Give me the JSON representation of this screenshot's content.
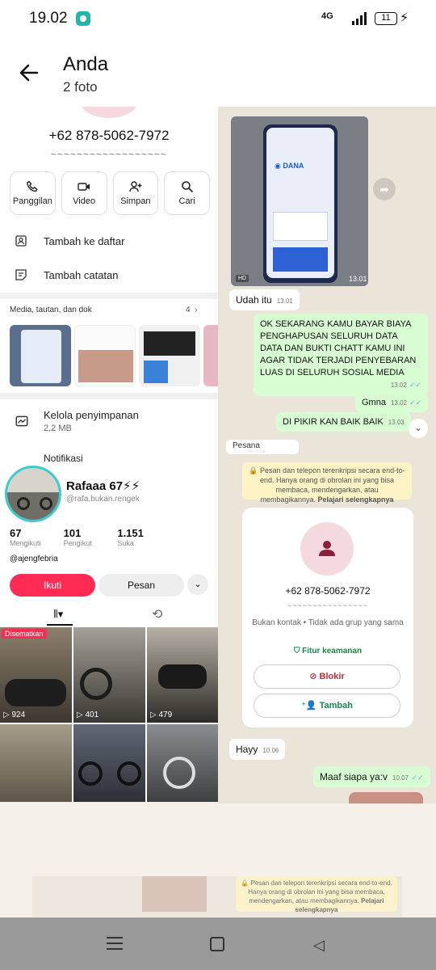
{
  "status_bar": {
    "time": "19.02",
    "network": "4G",
    "battery": "11"
  },
  "header": {
    "title": "Anda",
    "subtitle": "2 foto"
  },
  "contact": {
    "phone": "+62 878-5062-7972",
    "name_placeholder": "~~~~~~~~~~~~~~~~~~",
    "actions": [
      "Panggilan",
      "Video",
      "Simpan",
      "Cari"
    ],
    "rows": [
      "Tambah ke daftar",
      "Tambah catatan"
    ],
    "media_title": "Media, tautan, dan dok",
    "media_count": "4",
    "storage_title": "Kelola penyimpanan",
    "storage_size": "2,2 MB",
    "notif": "Notifikasi"
  },
  "chat": {
    "image_time": "13.01",
    "image_hd": "HD",
    "messages": [
      {
        "dir": "in",
        "text": "Udah itu",
        "time": "13.01"
      },
      {
        "dir": "out",
        "text": "OK SEKARANG KAMU BAYAR BIAYA PENGHAPUSAN SELURUH DATA DATA DAN BUKTI CHATT KAMU INI AGAR TIDAK TERJADI PENYEBARAN LUAS DI SELURUH SOSIAL MEDIA",
        "time": "13.02"
      },
      {
        "dir": "out",
        "text": "Gmna",
        "time": "13.02"
      },
      {
        "dir": "out",
        "text": "DI PIKIR KAN BAIK BAIK",
        "time": "13.03"
      }
    ],
    "fragment": "Pesana"
  },
  "tiktok": {
    "name": "Rafaaa 67⚡⚡",
    "handle": "@rafa.bukan.rengek",
    "stats": [
      {
        "num": "67",
        "label": "Mengikuti"
      },
      {
        "num": "101",
        "label": "Pengikut"
      },
      {
        "num": "1.151",
        "label": "Suka"
      }
    ],
    "bio_user": "@ajengfebria",
    "follow": "Ikuti",
    "message": "Pesan",
    "pinned": "Disematkan",
    "views": [
      "924",
      "401",
      "479"
    ]
  },
  "chat_info": {
    "encryption": "🔒 Pesan dan telepon terenkripsi secara end-to-end. Hanya orang di obrolan ini yang bisa membaca, mendengarkan, atau membagikannya.",
    "learn_more": "Pelajari selengkapnya",
    "phone": "+62 878-5062-7972",
    "tilde": "~~~~~~~~~~~~~~~~",
    "info": "Bukan kontak • Tidak ada grup yang sama",
    "security": "Fitur keamanan",
    "block": "Blokir",
    "add": "Tambah",
    "messages": [
      {
        "dir": "in",
        "text": "Hayy",
        "time": "10.06"
      },
      {
        "dir": "out",
        "text": "Maaf siapa ya:v",
        "time": "10.07"
      }
    ]
  },
  "ghost": {
    "encryption": "🔒 Pesan dan telepon terenkripsi secara end-to-end. Hanya orang di obrolan ini yang bisa membaca, mendengarkan, atau membagikannya.",
    "learn_more": "Pelajari selengkapnya"
  },
  "colors": {
    "whatsapp_green": "#d9fdd3",
    "tiktok_red": "#fe2c55",
    "accent_teal": "#25b5a6"
  }
}
